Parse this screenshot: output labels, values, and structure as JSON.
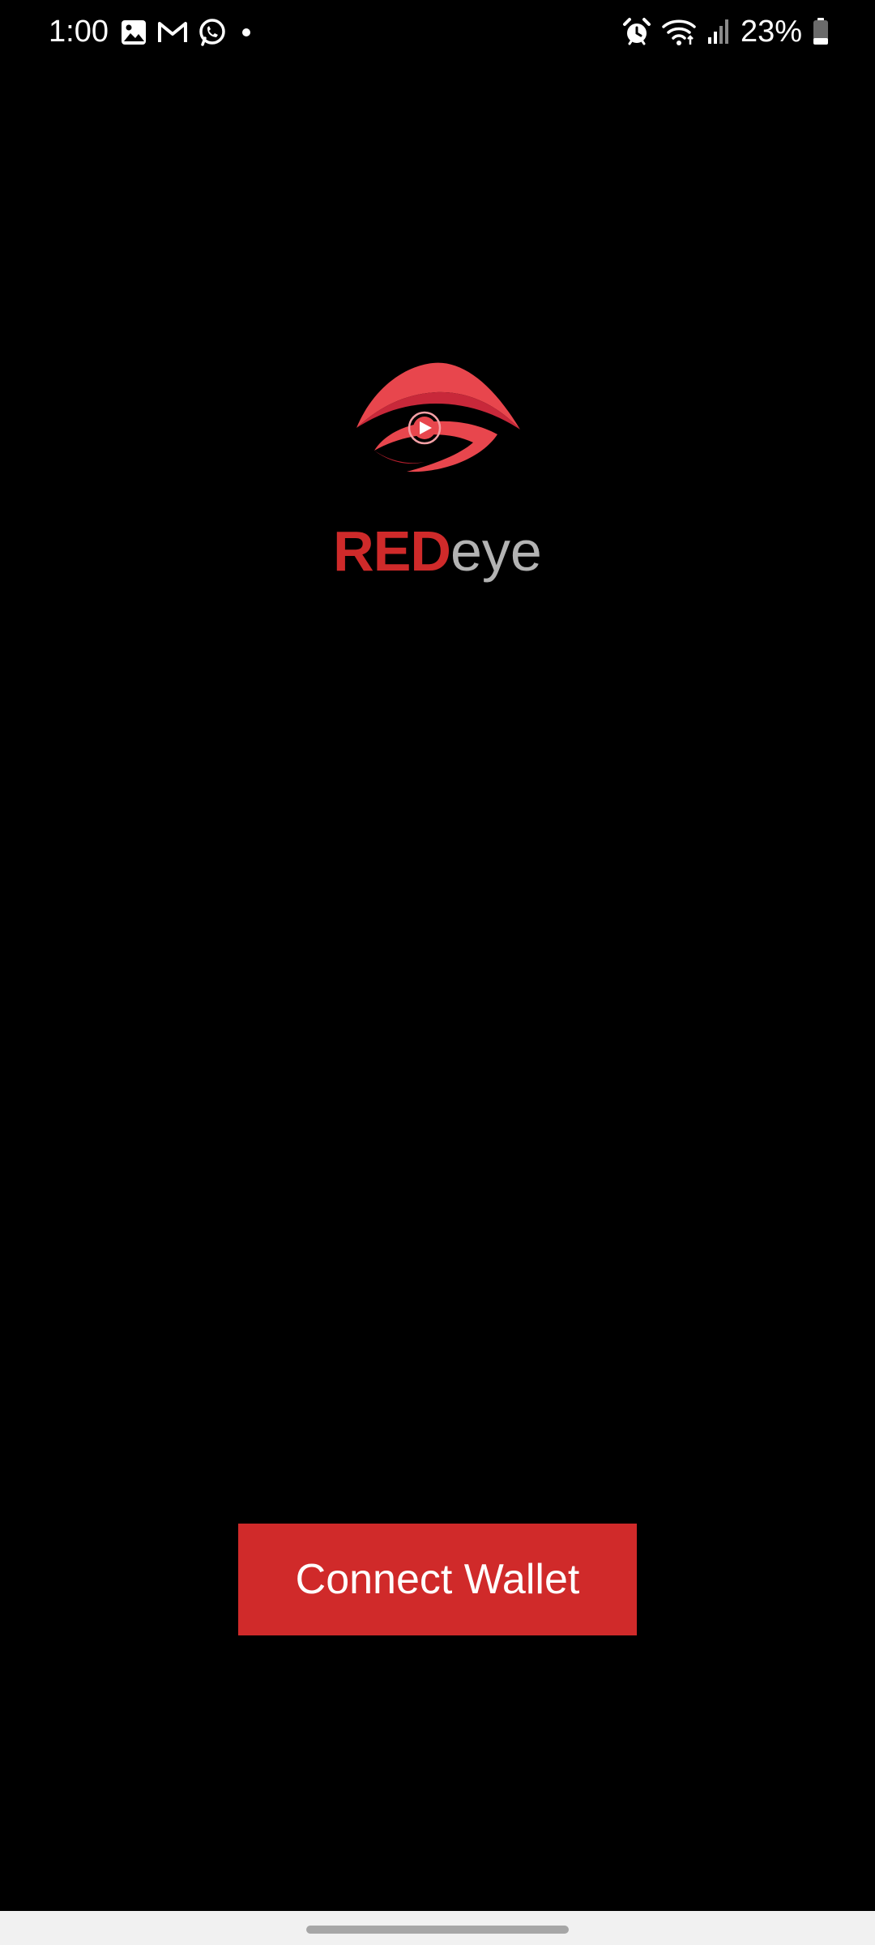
{
  "status_bar": {
    "time": "1:00",
    "battery_percent": "23%",
    "battery_level": 0.23,
    "left_icons": [
      "gallery-icon",
      "gmail-icon",
      "whatsapp-icon",
      "notification-dot-icon"
    ],
    "right_icons": [
      "alarm-icon",
      "wifi-icon",
      "signal-icon",
      "battery-icon"
    ]
  },
  "brand": {
    "part_red": "RED",
    "part_eye": "eye",
    "logo_icon": "red-eye-play-logo-icon"
  },
  "actions": {
    "connect_label": "Connect Wallet"
  },
  "colors": {
    "background": "#000000",
    "accent_red": "#d02a2a",
    "brand_grey": "#b3b3b3",
    "nav_bar": "#f1f1f1"
  }
}
